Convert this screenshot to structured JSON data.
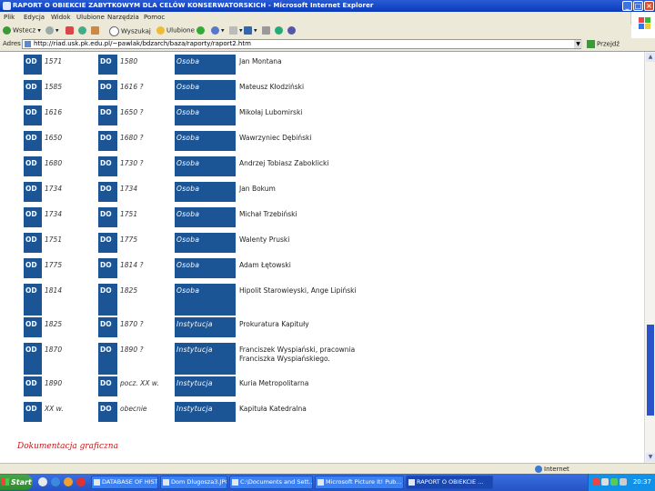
{
  "window": {
    "title": "RAPORT O OBIEKCIE ZABYTKOWYM DLA CELÓW KONSERWATORSKICH - Microsoft Internet Explorer"
  },
  "menu": [
    "Plik",
    "Edycja",
    "Widok",
    "Ulubione",
    "Narzędzia",
    "Pomoc"
  ],
  "toolbar": {
    "back": "Wstecz",
    "search": "Wyszukaj",
    "favorites": "Ulubione"
  },
  "address": {
    "label": "Adres",
    "url": "http://riad.usk.pk.edu.pl/~pawlak/bdzarch/baza/raporty/raport2.htm",
    "go": "Przejdź"
  },
  "table": {
    "labels": {
      "from": "OD",
      "to": "DO"
    },
    "rows": [
      {
        "from": "1571",
        "to": "1580",
        "type": "Osoba",
        "name": "Jan Montana"
      },
      {
        "from": "1585",
        "to": "1616 ?",
        "type": "Osoba",
        "name": "Mateusz Kłodziński"
      },
      {
        "from": "1616",
        "to": "1650 ?",
        "type": "Osoba",
        "name": "Mikołaj Lubomirski"
      },
      {
        "from": "1650",
        "to": "1680 ?",
        "type": "Osoba",
        "name": "Wawrzyniec Dębiński"
      },
      {
        "from": "1680",
        "to": "1730 ?",
        "type": "Osoba",
        "name": "Andrzej Tobiasz Zaboklicki"
      },
      {
        "from": "1734",
        "to": "1734",
        "type": "Osoba",
        "name": "Jan Bokum"
      },
      {
        "from": "1734",
        "to": "1751",
        "type": "Osoba",
        "name": "Michał Trzebiński"
      },
      {
        "from": "1751",
        "to": "1775",
        "type": "Osoba",
        "name": "Walenty Pruski"
      },
      {
        "from": "1775",
        "to": "1814 ?",
        "type": "Osoba",
        "name": "Adam Łętowski"
      },
      {
        "from": "1814",
        "to": "1825",
        "type": "Osoba",
        "name": "Hipolit Starowieyski, Ange Lipiński"
      },
      {
        "from": "1825",
        "to": "1870 ?",
        "type": "Instytucja",
        "name": "Prokuratura Kapituły"
      },
      {
        "from": "1870",
        "to": "1890 ?",
        "type": "Instytucja",
        "name": "Franciszek Wyspiański, pracownia Franciszka Wyspiańskiego."
      },
      {
        "from": "1890",
        "to": "pocz. XX w.",
        "type": "Instytucja",
        "name": "Kuria Metropolitarna"
      },
      {
        "from": "XX w.",
        "to": "obecnie",
        "type": "Instytucja",
        "name": "Kapituła Katedralna"
      }
    ]
  },
  "section": {
    "docs": "Dokumentacja graficzna"
  },
  "status": {
    "zone": "Internet"
  },
  "taskbar": {
    "start": "Start",
    "tasks": [
      {
        "label": "DATABASE OF HISTORI...",
        "active": false
      },
      {
        "label": "Dom Dlugosza3.JPG - P...",
        "active": false
      },
      {
        "label": "C:\\Documents and Sett...",
        "active": false
      },
      {
        "label": "Microsoft Picture It! Pub...",
        "active": false
      },
      {
        "label": "RAPORT O OBIEKCIE ...",
        "active": true
      }
    ],
    "clock": "20:37"
  },
  "colors": {
    "cell": "#1c5596",
    "titlebar": "#0a3ab8",
    "section": "#c01818",
    "taskbar": "#2453c4"
  }
}
